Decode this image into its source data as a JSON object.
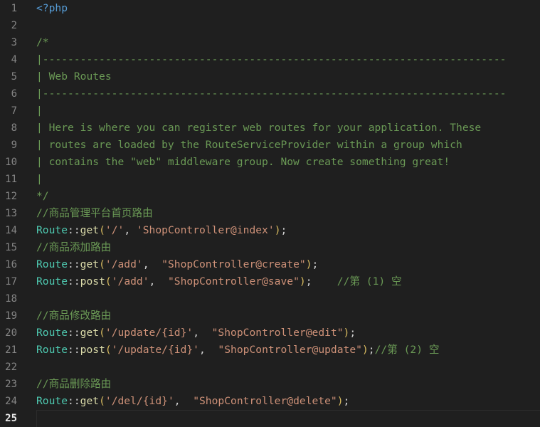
{
  "editor": {
    "app": "code-editor",
    "language": "php",
    "theme": "dark-plus",
    "background_color": "#1f1f1f",
    "gutter_color": "#858585",
    "active_gutter_color": "#e8e8e8",
    "active_line_number": 25,
    "total_lines": 25,
    "colors": {
      "php_tag": "#569cd6",
      "comment": "#6a9955",
      "class_name": "#4ec9b0",
      "function_name": "#dcdcaa",
      "paren": "#d7ba5f",
      "string": "#ce9178",
      "punctuation": "#d4d4d4"
    }
  },
  "lines": [
    {
      "number": "1",
      "tokens": [
        {
          "text": "<?php",
          "type": "t-php"
        }
      ]
    },
    {
      "number": "2",
      "tokens": []
    },
    {
      "number": "3",
      "tokens": [
        {
          "text": "/*",
          "type": "t-comment"
        }
      ]
    },
    {
      "number": "4",
      "tokens": [
        {
          "text": "|--------------------------------------------------------------------------",
          "type": "t-comment"
        }
      ]
    },
    {
      "number": "5",
      "tokens": [
        {
          "text": "| Web Routes",
          "type": "t-comment"
        }
      ]
    },
    {
      "number": "6",
      "tokens": [
        {
          "text": "|--------------------------------------------------------------------------",
          "type": "t-comment"
        }
      ]
    },
    {
      "number": "7",
      "tokens": [
        {
          "text": "|",
          "type": "t-comment"
        }
      ]
    },
    {
      "number": "8",
      "tokens": [
        {
          "text": "| Here is where you can register web routes for your application. These",
          "type": "t-comment"
        }
      ]
    },
    {
      "number": "9",
      "tokens": [
        {
          "text": "| routes are loaded by the RouteServiceProvider within a group which",
          "type": "t-comment"
        }
      ]
    },
    {
      "number": "10",
      "tokens": [
        {
          "text": "| contains the \"web\" middleware group. Now create something great!",
          "type": "t-comment"
        }
      ]
    },
    {
      "number": "11",
      "tokens": [
        {
          "text": "|",
          "type": "t-comment"
        }
      ]
    },
    {
      "number": "12",
      "tokens": [
        {
          "text": "*/",
          "type": "t-comment"
        }
      ]
    },
    {
      "number": "13",
      "tokens": [
        {
          "text": "//商品管理平台首页路由",
          "type": "t-comment"
        }
      ]
    },
    {
      "number": "14",
      "tokens": [
        {
          "text": "Route",
          "type": "t-class"
        },
        {
          "text": "::",
          "type": "t-op"
        },
        {
          "text": "get",
          "type": "t-func"
        },
        {
          "text": "(",
          "type": "t-paren"
        },
        {
          "text": "'/'",
          "type": "t-string"
        },
        {
          "text": ", ",
          "type": "t-punct"
        },
        {
          "text": "'ShopController@index'",
          "type": "t-string"
        },
        {
          "text": ")",
          "type": "t-paren"
        },
        {
          "text": ";",
          "type": "t-punct"
        }
      ]
    },
    {
      "number": "15",
      "tokens": [
        {
          "text": "//商品添加路由",
          "type": "t-comment"
        }
      ]
    },
    {
      "number": "16",
      "tokens": [
        {
          "text": "Route",
          "type": "t-class"
        },
        {
          "text": "::",
          "type": "t-op"
        },
        {
          "text": "get",
          "type": "t-func"
        },
        {
          "text": "(",
          "type": "t-paren"
        },
        {
          "text": "'/add'",
          "type": "t-string"
        },
        {
          "text": ",  ",
          "type": "t-punct"
        },
        {
          "text": "\"ShopController@create\"",
          "type": "t-string"
        },
        {
          "text": ")",
          "type": "t-paren"
        },
        {
          "text": ";",
          "type": "t-punct"
        }
      ]
    },
    {
      "number": "17",
      "tokens": [
        {
          "text": "Route",
          "type": "t-class"
        },
        {
          "text": "::",
          "type": "t-op"
        },
        {
          "text": "post",
          "type": "t-func"
        },
        {
          "text": "(",
          "type": "t-paren"
        },
        {
          "text": "'/add'",
          "type": "t-string"
        },
        {
          "text": ",  ",
          "type": "t-punct"
        },
        {
          "text": "\"ShopController@save\"",
          "type": "t-string"
        },
        {
          "text": ")",
          "type": "t-paren"
        },
        {
          "text": ";",
          "type": "t-punct"
        },
        {
          "text": "    ",
          "type": "t-punct"
        },
        {
          "text": "//第 (1) 空",
          "type": "t-comment"
        }
      ]
    },
    {
      "number": "18",
      "tokens": []
    },
    {
      "number": "19",
      "tokens": [
        {
          "text": "//商品修改路由",
          "type": "t-comment"
        }
      ]
    },
    {
      "number": "20",
      "tokens": [
        {
          "text": "Route",
          "type": "t-class"
        },
        {
          "text": "::",
          "type": "t-op"
        },
        {
          "text": "get",
          "type": "t-func"
        },
        {
          "text": "(",
          "type": "t-paren"
        },
        {
          "text": "'/update/{id}'",
          "type": "t-string"
        },
        {
          "text": ",  ",
          "type": "t-punct"
        },
        {
          "text": "\"ShopController@edit\"",
          "type": "t-string"
        },
        {
          "text": ")",
          "type": "t-paren"
        },
        {
          "text": ";",
          "type": "t-punct"
        }
      ]
    },
    {
      "number": "21",
      "tokens": [
        {
          "text": "Route",
          "type": "t-class"
        },
        {
          "text": "::",
          "type": "t-op"
        },
        {
          "text": "post",
          "type": "t-func"
        },
        {
          "text": "(",
          "type": "t-paren"
        },
        {
          "text": "'/update/{id}'",
          "type": "t-string"
        },
        {
          "text": ",  ",
          "type": "t-punct"
        },
        {
          "text": "\"ShopController@update\"",
          "type": "t-string"
        },
        {
          "text": ")",
          "type": "t-paren"
        },
        {
          "text": ";",
          "type": "t-punct"
        },
        {
          "text": "//第 (2) 空",
          "type": "t-comment"
        }
      ]
    },
    {
      "number": "22",
      "tokens": []
    },
    {
      "number": "23",
      "tokens": [
        {
          "text": "//商品删除路由",
          "type": "t-comment"
        }
      ]
    },
    {
      "number": "24",
      "tokens": [
        {
          "text": "Route",
          "type": "t-class"
        },
        {
          "text": "::",
          "type": "t-op"
        },
        {
          "text": "get",
          "type": "t-func"
        },
        {
          "text": "(",
          "type": "t-paren"
        },
        {
          "text": "'/del/{id}'",
          "type": "t-string"
        },
        {
          "text": ",  ",
          "type": "t-punct"
        },
        {
          "text": "\"ShopController@delete\"",
          "type": "t-string"
        },
        {
          "text": ")",
          "type": "t-paren"
        },
        {
          "text": ";",
          "type": "t-punct"
        }
      ]
    },
    {
      "number": "25",
      "tokens": [],
      "active": true
    }
  ]
}
